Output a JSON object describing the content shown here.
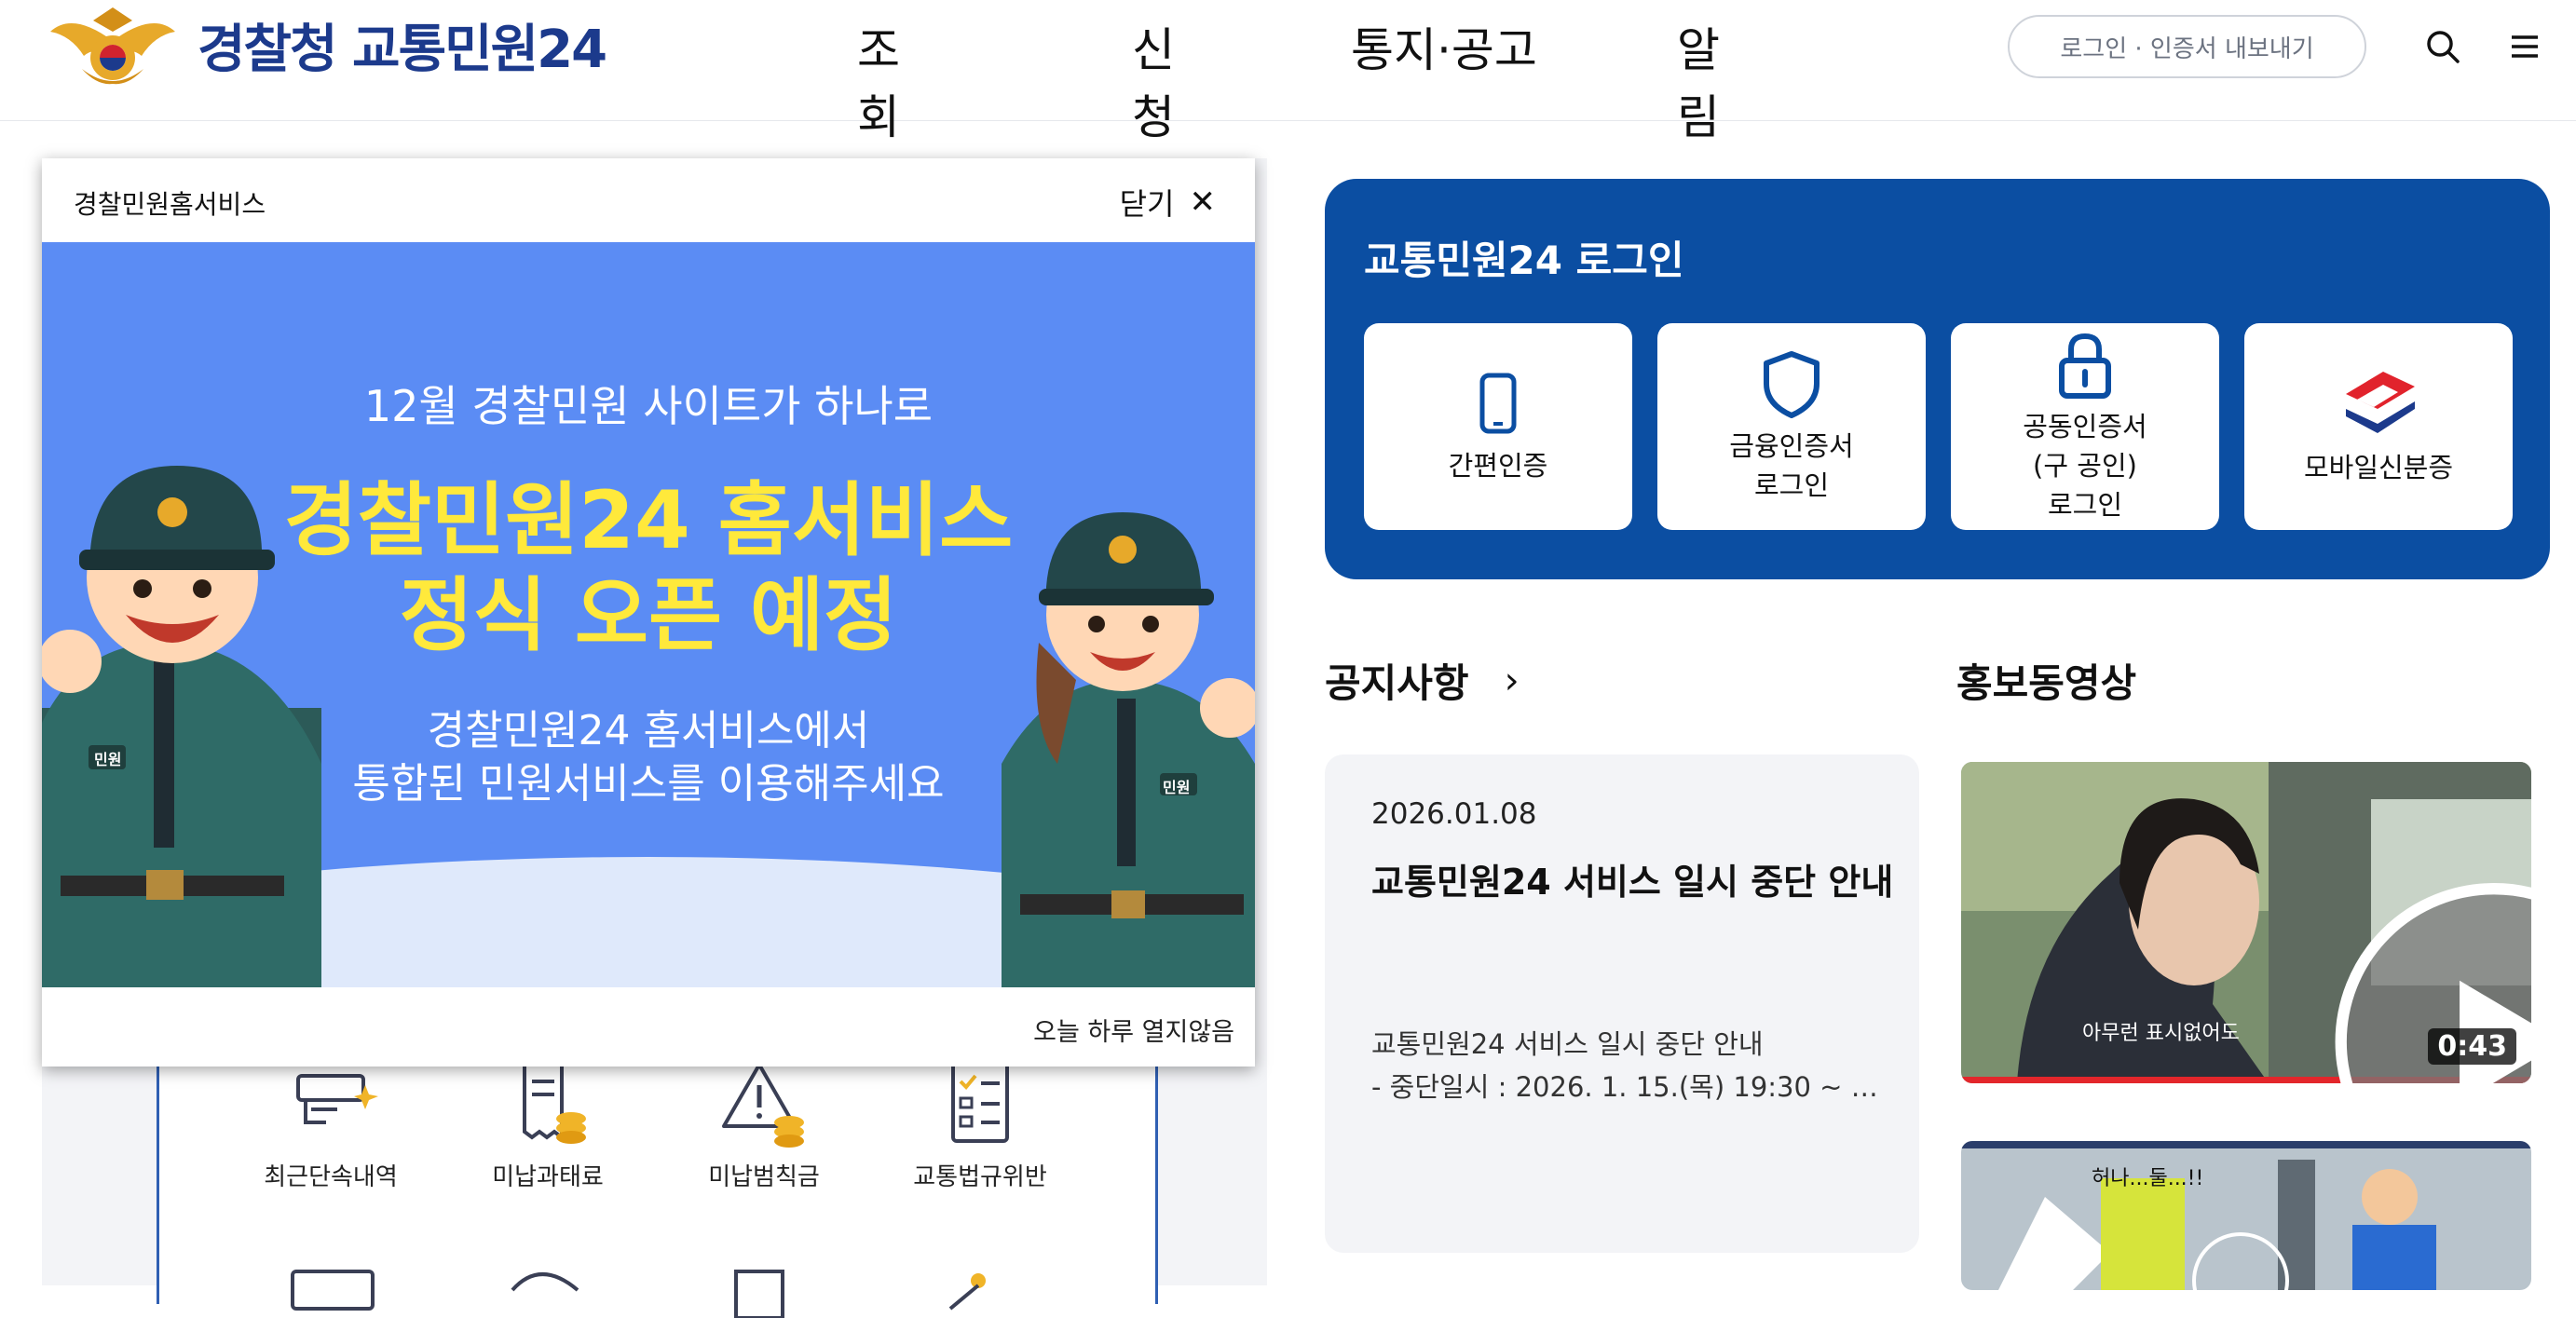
{
  "header": {
    "logo_text": "경찰청 교통민원24",
    "nav": [
      "조회",
      "신청",
      "통지·공고",
      "알림"
    ],
    "login_pill": "로그인 · 인증서 내보내기",
    "icons": [
      "search-icon",
      "menu-icon"
    ]
  },
  "popup": {
    "title": "경찰민원홈서비스",
    "close_label": "닫기",
    "banner": {
      "top": "12월 경찰민원 사이트가 하나로",
      "main1": "경찰민원24 홈서비스",
      "main2": "정식 오픈 예정",
      "sub1": "경찰민원24 홈서비스에서",
      "sub2": "통합된 민원서비스를 이용해주세요",
      "badge_left": "민원",
      "badge_right": "민원"
    },
    "not_today": "오늘 하루 열지않음"
  },
  "services": [
    {
      "label": "최근단속내역",
      "icon": "camera-icon"
    },
    {
      "label": "미납과태료",
      "icon": "bill-coins-icon"
    },
    {
      "label": "미납범칙금",
      "icon": "warning-coins-icon"
    },
    {
      "label": "교통법규위반",
      "icon": "checklist-icon"
    }
  ],
  "login": {
    "title": "교통민원24 로그인",
    "buttons": [
      {
        "label": "간편인증",
        "icon": "phone-icon"
      },
      {
        "label": "금융인증서\n로그인",
        "icon": "shield-icon"
      },
      {
        "label": "공동인증서\n(구 공인)\n로그인",
        "icon": "lock-icon"
      },
      {
        "label": "모바일신분증",
        "icon": "mobile-id-icon"
      }
    ]
  },
  "notice": {
    "section_title": "공지사항",
    "date": "2026.01.08",
    "headline": "교통민원24 서비스 일시 중단 안내",
    "body_line1": "교통민원24 서비스 일시 중단 안내",
    "body_line2": "- 중단일시 : 2026. 1. 15.(목) 19:30 ~ 2…"
  },
  "promo": {
    "section_title": "홍보동영상",
    "video1": {
      "duration": "0:43",
      "caption": "아무런 표시없어도"
    },
    "video2": {
      "caption": "허나...둘...!!"
    }
  },
  "colors": {
    "brand_blue": "#0b4ea2",
    "banner_blue": "#5b8cf4",
    "banner_yellow": "#ffe93b",
    "logo_navy": "#1c3a8c"
  }
}
